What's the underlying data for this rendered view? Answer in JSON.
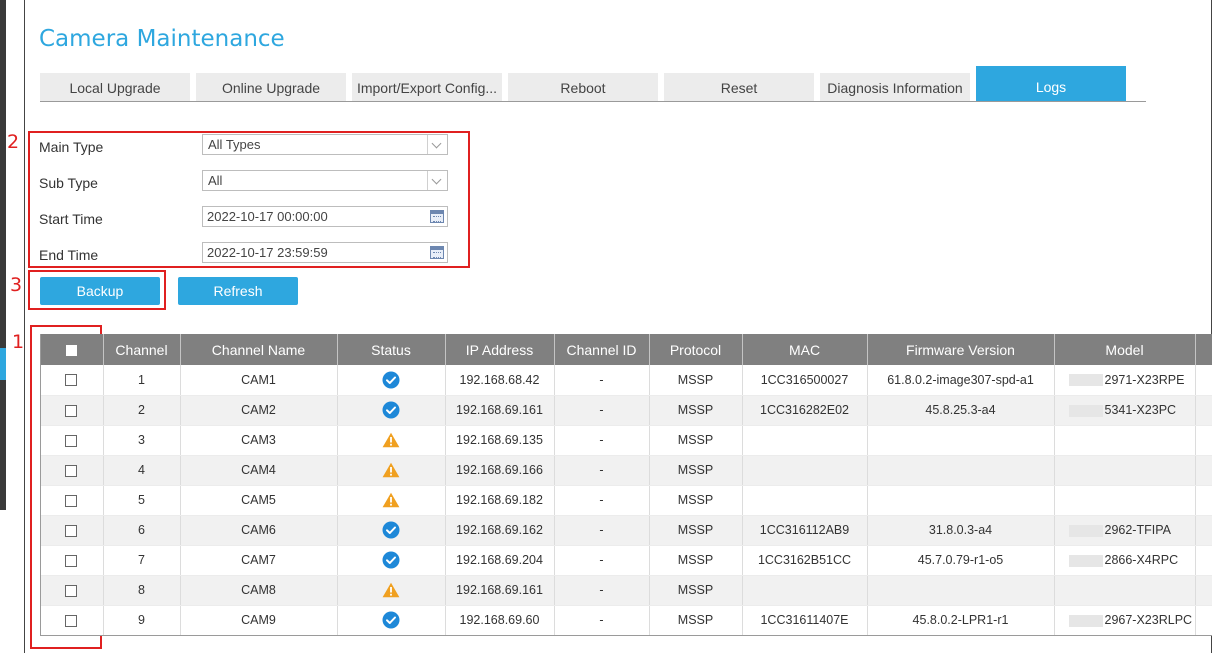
{
  "page": {
    "title": "Camera Maintenance"
  },
  "tabs": [
    {
      "label": "Local Upgrade",
      "active": false
    },
    {
      "label": "Online Upgrade",
      "active": false
    },
    {
      "label": "Import/Export Config...",
      "active": false
    },
    {
      "label": "Reboot",
      "active": false
    },
    {
      "label": "Reset",
      "active": false
    },
    {
      "label": "Diagnosis Information",
      "active": false
    },
    {
      "label": "Logs",
      "active": true
    }
  ],
  "annotations": [
    "1",
    "2",
    "3"
  ],
  "filters": {
    "main_type": {
      "label": "Main Type",
      "value": "All Types"
    },
    "sub_type": {
      "label": "Sub Type",
      "value": "All"
    },
    "start_time": {
      "label": "Start Time",
      "value": "2022-10-17 00:00:00"
    },
    "end_time": {
      "label": "End Time",
      "value": "2022-10-17 23:59:59"
    }
  },
  "buttons": {
    "backup": "Backup",
    "refresh": "Refresh"
  },
  "table": {
    "columns": [
      "Channel",
      "Channel Name",
      "Status",
      "IP Address",
      "Channel ID",
      "Protocol",
      "MAC",
      "Firmware Version",
      "Model"
    ],
    "rows": [
      {
        "channel": "1",
        "name": "CAM1",
        "status": "ok",
        "ip": "192.168.68.42",
        "channel_id": "-",
        "protocol": "MSSP",
        "mac": "1CC316500027",
        "firmware": "61.8.0.2-image307-spd-a1",
        "model": "2971-X23RPE"
      },
      {
        "channel": "2",
        "name": "CAM2",
        "status": "ok",
        "ip": "192.168.69.161",
        "channel_id": "-",
        "protocol": "MSSP",
        "mac": "1CC316282E02",
        "firmware": "45.8.25.3-a4",
        "model": "5341-X23PC"
      },
      {
        "channel": "3",
        "name": "CAM3",
        "status": "warning",
        "ip": "192.168.69.135",
        "channel_id": "-",
        "protocol": "MSSP",
        "mac": "",
        "firmware": "",
        "model": ""
      },
      {
        "channel": "4",
        "name": "CAM4",
        "status": "warning",
        "ip": "192.168.69.166",
        "channel_id": "-",
        "protocol": "MSSP",
        "mac": "",
        "firmware": "",
        "model": ""
      },
      {
        "channel": "5",
        "name": "CAM5",
        "status": "warning",
        "ip": "192.168.69.182",
        "channel_id": "-",
        "protocol": "MSSP",
        "mac": "",
        "firmware": "",
        "model": ""
      },
      {
        "channel": "6",
        "name": "CAM6",
        "status": "ok",
        "ip": "192.168.69.162",
        "channel_id": "-",
        "protocol": "MSSP",
        "mac": "1CC316112AB9",
        "firmware": "31.8.0.3-a4",
        "model": "2962-TFIPA"
      },
      {
        "channel": "7",
        "name": "CAM7",
        "status": "ok",
        "ip": "192.168.69.204",
        "channel_id": "-",
        "protocol": "MSSP",
        "mac": "1CC3162B51CC",
        "firmware": "45.7.0.79-r1-o5",
        "model": "2866-X4RPC"
      },
      {
        "channel": "8",
        "name": "CAM8",
        "status": "warning",
        "ip": "192.168.69.161",
        "channel_id": "-",
        "protocol": "MSSP",
        "mac": "",
        "firmware": "",
        "model": ""
      },
      {
        "channel": "9",
        "name": "CAM9",
        "status": "ok",
        "ip": "192.168.69.60",
        "channel_id": "-",
        "protocol": "MSSP",
        "mac": "1CC31611407E",
        "firmware": "45.8.0.2-LPR1-r1",
        "model": "2967-X23RLPC"
      }
    ]
  },
  "colors": {
    "accent": "#2ea7df",
    "annotation": "#e02020",
    "header_bg": "#808080",
    "ok": "#1e88d8",
    "warning": "#f0a020"
  }
}
